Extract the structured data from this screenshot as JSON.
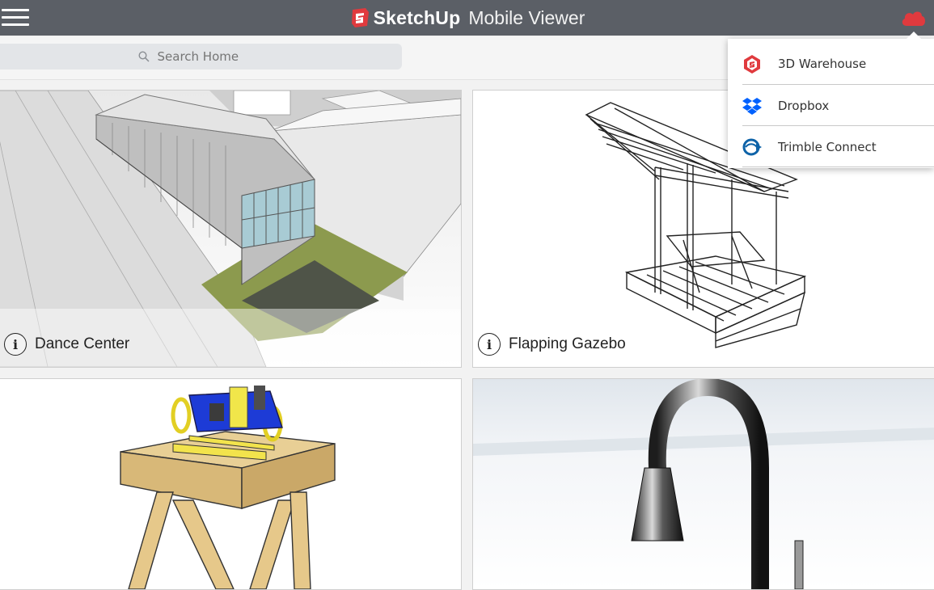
{
  "app": {
    "brand_name": "SketchUp",
    "brand_sub": "Mobile Viewer"
  },
  "search": {
    "placeholder": "Search Home"
  },
  "cards": [
    {
      "title": "Dance Center"
    },
    {
      "title": "Flapping Gazebo"
    },
    {
      "title": ""
    },
    {
      "title": ""
    }
  ],
  "cloud_menu": {
    "items": [
      {
        "label": "3D Warehouse",
        "icon": "3d-warehouse-icon"
      },
      {
        "label": "Dropbox",
        "icon": "dropbox-icon"
      },
      {
        "label": "Trimble Connect",
        "icon": "trimble-connect-icon"
      }
    ]
  },
  "colors": {
    "topbar": "#5b5f66",
    "cloud_accent": "#e03a3e",
    "dropbox_blue": "#0061fe",
    "trimble_blue": "#0e63a8"
  }
}
